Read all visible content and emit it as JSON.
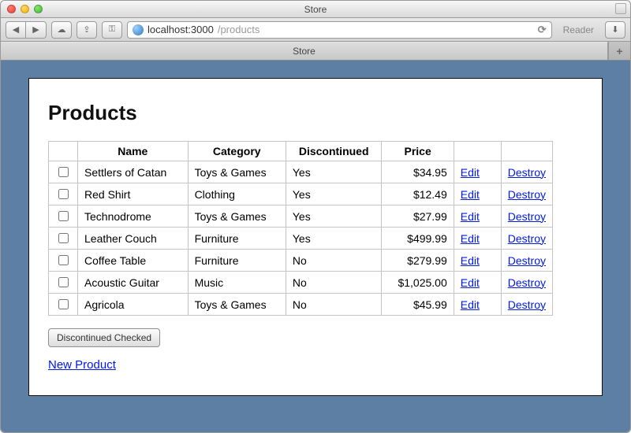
{
  "window": {
    "title": "Store"
  },
  "browser": {
    "url_host": "localhost:3000",
    "url_path": "/products",
    "reader_label": "Reader",
    "tab_title": "Store"
  },
  "page": {
    "heading": "Products",
    "table": {
      "headers": {
        "name": "Name",
        "category": "Category",
        "discontinued": "Discontinued",
        "price": "Price"
      },
      "rows": [
        {
          "name": "Settlers of Catan",
          "category": "Toys & Games",
          "discontinued": "Yes",
          "price": "$34.95"
        },
        {
          "name": "Red Shirt",
          "category": "Clothing",
          "discontinued": "Yes",
          "price": "$12.49"
        },
        {
          "name": "Technodrome",
          "category": "Toys & Games",
          "discontinued": "Yes",
          "price": "$27.99"
        },
        {
          "name": "Leather Couch",
          "category": "Furniture",
          "discontinued": "Yes",
          "price": "$499.99"
        },
        {
          "name": "Coffee Table",
          "category": "Furniture",
          "discontinued": "No",
          "price": "$279.99"
        },
        {
          "name": "Acoustic Guitar",
          "category": "Music",
          "discontinued": "No",
          "price": "$1,025.00"
        },
        {
          "name": "Agricola",
          "category": "Toys & Games",
          "discontinued": "No",
          "price": "$45.99"
        }
      ],
      "edit_label": "Edit",
      "destroy_label": "Destroy"
    },
    "discontinue_button": "Discontinued Checked",
    "new_product_link": "New Product"
  }
}
